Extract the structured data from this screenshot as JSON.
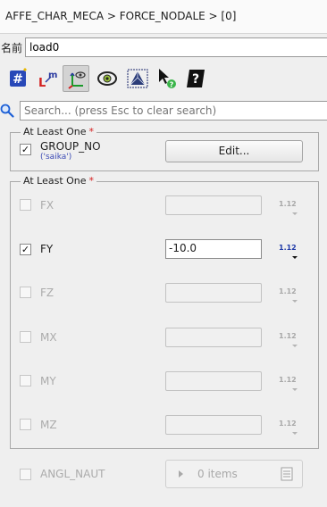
{
  "breadcrumb": "AFFE_CHAR_MECA > FORCE_NODALE > [0]",
  "name_field": {
    "label": "名前",
    "value": "load0"
  },
  "toolbar": {
    "icons": [
      "hash-icon",
      "local-frame-icon",
      "axes-view-icon",
      "eye-icon",
      "mesh-icon",
      "pointer-help-icon",
      "help-icon"
    ],
    "active": "axes-view-icon"
  },
  "search": {
    "placeholder": "Search... (press Esc to clear search)",
    "value": ""
  },
  "group1": {
    "title": "At Least One",
    "required_mark": "*",
    "field": {
      "label": "GROUP_NO",
      "sub_label": "('saika')",
      "checked": true,
      "check_mark": "✓",
      "button": "Edit..."
    }
  },
  "group2": {
    "title": "At Least One",
    "required_mark": "*",
    "fields": [
      {
        "label": "FX",
        "value": "",
        "checked": false,
        "enabled": false,
        "badge": "1.12"
      },
      {
        "label": "FY",
        "value": "-10.0",
        "checked": true,
        "enabled": true,
        "badge": "1.12"
      },
      {
        "label": "FZ",
        "value": "",
        "checked": false,
        "enabled": false,
        "badge": "1.12"
      },
      {
        "label": "MX",
        "value": "",
        "checked": false,
        "enabled": false,
        "badge": "1.12"
      },
      {
        "label": "MY",
        "value": "",
        "checked": false,
        "enabled": false,
        "badge": "1.12"
      },
      {
        "label": "MZ",
        "value": "",
        "checked": false,
        "enabled": false,
        "badge": "1.12"
      }
    ]
  },
  "angl_naut": {
    "label": "ANGL_NAUT",
    "checked": false,
    "items_text": "0 items"
  },
  "colors": {
    "accent_blue": "#1f3aa8",
    "required_red": "#d62020",
    "disabled_text": "#ababab"
  }
}
